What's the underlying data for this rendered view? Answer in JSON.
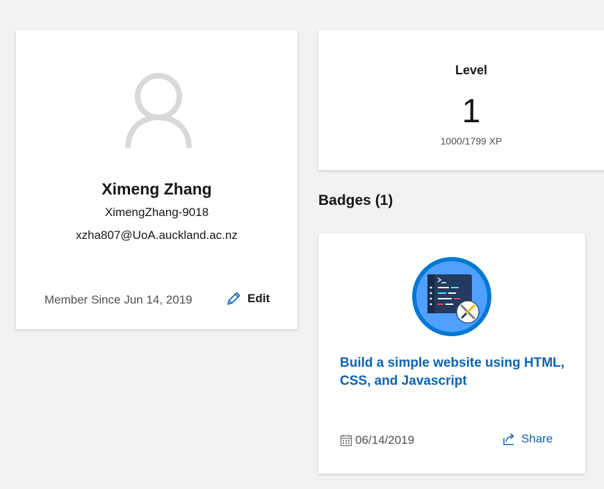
{
  "profile": {
    "name": "Ximeng Zhang",
    "username": "XimengZhang-9018",
    "email": "xzha807@UoA.auckland.ac.nz",
    "member_since": "Member Since Jun 14, 2019",
    "edit_label": "Edit",
    "avatar_icon": "person-outline-icon",
    "edit_icon": "pencil-icon"
  },
  "level": {
    "title": "Level",
    "value": "1",
    "xp": "1000/1799 XP"
  },
  "badges": {
    "heading": "Badges (1)",
    "items": [
      {
        "title": "Build a simple website using HTML, CSS, and Javascript",
        "date": "06/14/2019",
        "share_label": "Share",
        "icon": "code-editor-tools-badge-icon",
        "date_icon": "calendar-icon",
        "share_icon": "share-icon"
      }
    ]
  },
  "colors": {
    "background": "#f2f2f2",
    "card": "#ffffff",
    "link": "#0b63b0",
    "muted_text": "#505050",
    "badge_ring": "#0078d4",
    "badge_fill": "#50a0ff"
  }
}
